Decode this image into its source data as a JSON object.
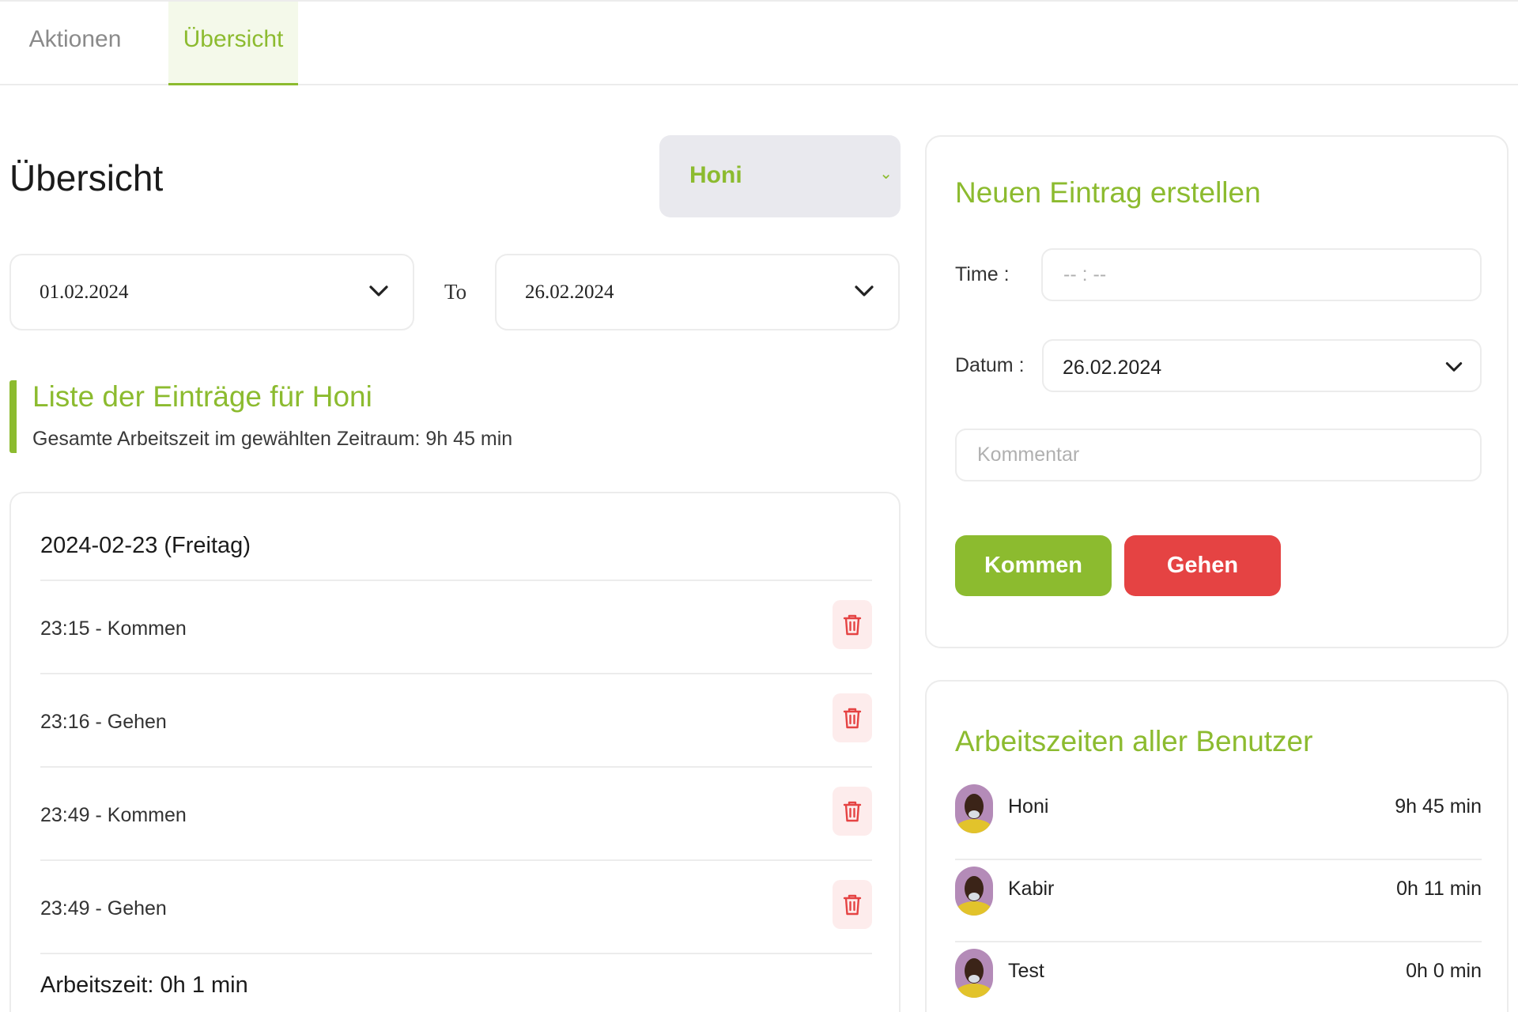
{
  "tabs": [
    {
      "label": "Aktionen",
      "active": false
    },
    {
      "label": "Übersicht",
      "active": true
    }
  ],
  "overview": {
    "title": "Übersicht",
    "user_select": {
      "value": "Honi"
    },
    "date_from": "01.02.2024",
    "to_label": "To",
    "date_to": "26.02.2024",
    "list_title": "Liste der Einträge für Honi",
    "total_label": "Gesamte Arbeitszeit im gewählten Zeitraum: 9h 45 min"
  },
  "entries": {
    "day_title": "2024-02-23 (Freitag)",
    "items": [
      {
        "text": "23:15 - Kommen"
      },
      {
        "text": "23:16 - Gehen"
      },
      {
        "text": "23:49 - Kommen"
      },
      {
        "text": "23:49 - Gehen"
      }
    ],
    "worktime": "Arbeitszeit: 0h 1 min"
  },
  "new_entry": {
    "title": "Neuen Eintrag erstellen",
    "time_label": "Time :",
    "time_placeholder": "-- : --",
    "date_label": "Datum :",
    "date_value": "26.02.2024",
    "comment_placeholder": "Kommentar",
    "come_label": "Kommen",
    "go_label": "Gehen"
  },
  "users": {
    "title": "Arbeitszeiten aller Benutzer",
    "items": [
      {
        "name": "Honi",
        "hours": "9h 45 min"
      },
      {
        "name": "Kabir",
        "hours": "0h 11 min"
      },
      {
        "name": "Test",
        "hours": "0h 0 min"
      }
    ]
  },
  "colors": {
    "accent_green": "#8cbb2f",
    "danger_red": "#e54343",
    "trash_bg": "#fdecec"
  },
  "icons": {
    "delete": "trash-icon",
    "dropdown": "chevron-down-icon",
    "avatar": "user-avatar"
  }
}
